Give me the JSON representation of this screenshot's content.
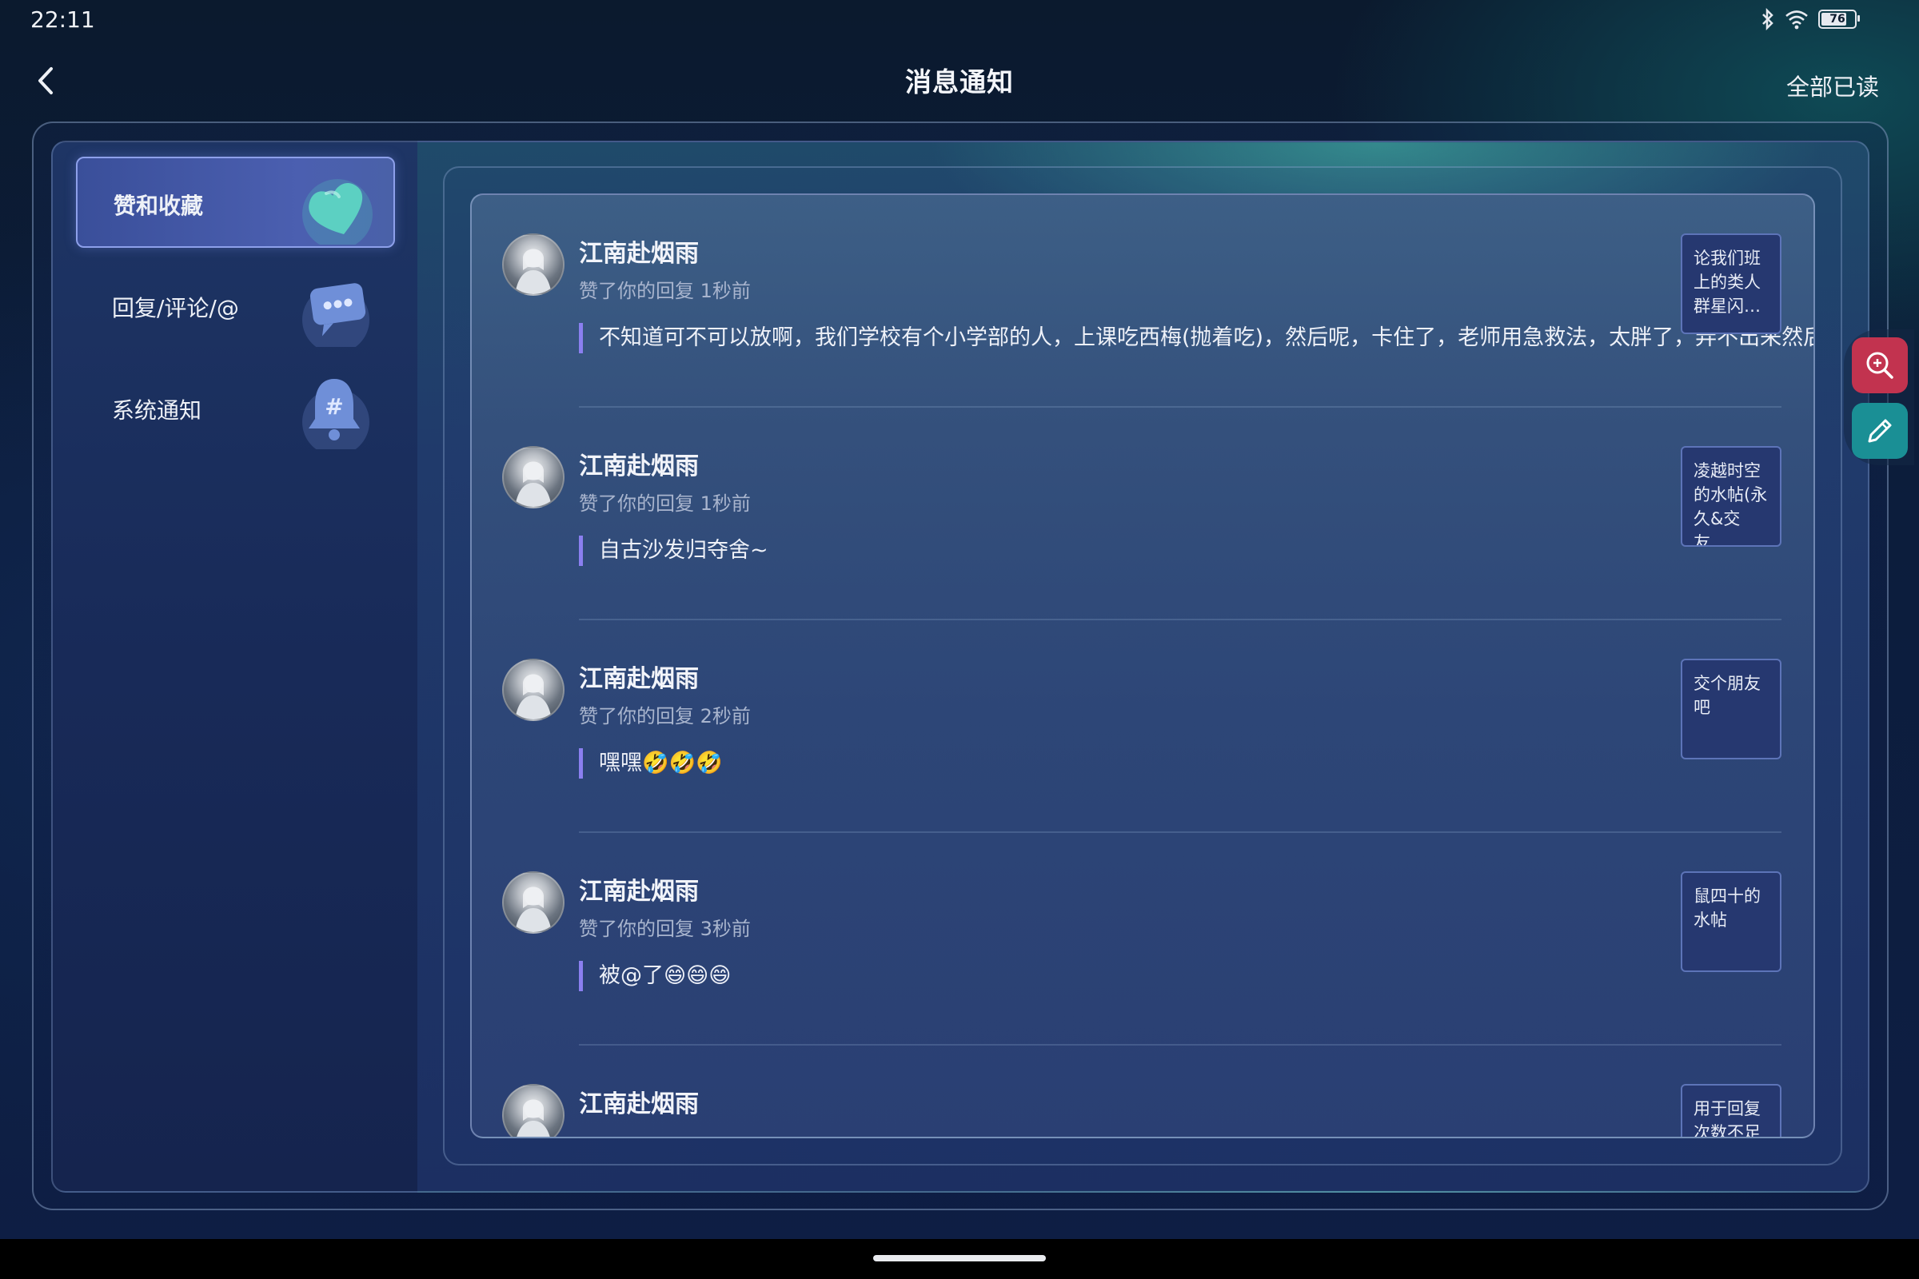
{
  "status_bar": {
    "time": "22:11",
    "battery_level": "76"
  },
  "header": {
    "title": "消息通知",
    "mark_all_read": "全部已读"
  },
  "sidebar": {
    "tabs": [
      {
        "label": "赞和收藏",
        "icon": "heart-icon",
        "active": true
      },
      {
        "label": "回复/评论/@",
        "icon": "chat-bubble-icon",
        "active": false
      },
      {
        "label": "系统通知",
        "icon": "bell-icon",
        "active": false
      }
    ]
  },
  "notifications": [
    {
      "username": "江南赴烟雨",
      "action": "赞了你的回复",
      "time": "1秒前",
      "reply": "不知道可不可以放啊，我们学校有个小学部的人，上课吃西梅(抛着吃)，然后呢，卡住了，老师用急救法，太胖了，弄不出来然后.",
      "thumb": "论我们班上的类人群星闪…"
    },
    {
      "username": "江南赴烟雨",
      "action": "赞了你的回复",
      "time": "1秒前",
      "reply": "自古沙发归夺舍~",
      "thumb": "凌越时空的水帖(永久&交友…"
    },
    {
      "username": "江南赴烟雨",
      "action": "赞了你的回复",
      "time": "2秒前",
      "reply": "嘿嘿🤣🤣🤣",
      "thumb": "交个朋友吧"
    },
    {
      "username": "江南赴烟雨",
      "action": "赞了你的回复",
      "time": "3秒前",
      "reply": "被@了😄😄😄",
      "thumb": "鼠四十的水帖"
    },
    {
      "username": "江南赴烟雨",
      "action": "",
      "time": "",
      "reply": "",
      "thumb": "用于回复次数不足"
    }
  ],
  "floating_tools": [
    {
      "icon": "zoom-in-icon"
    },
    {
      "icon": "pencil-icon"
    }
  ],
  "colors": {
    "active_tab": "#4b5fb0",
    "quote_bar": "#8b7ff0",
    "search_fab": "#c2334f",
    "edit_fab": "#1a8f95"
  }
}
